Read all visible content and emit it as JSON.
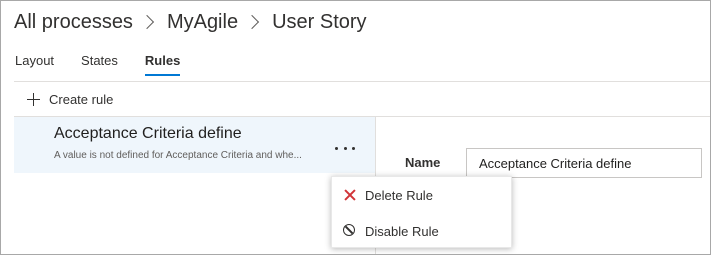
{
  "breadcrumb": {
    "items": [
      "All processes",
      "MyAgile",
      "User Story"
    ]
  },
  "tabs": [
    {
      "label": "Layout",
      "active": false
    },
    {
      "label": "States",
      "active": false
    },
    {
      "label": "Rules",
      "active": true
    }
  ],
  "toolbar": {
    "create_rule_label": "Create rule"
  },
  "rules": [
    {
      "title": "Acceptance Criteria define",
      "description": "A value is not defined for Acceptance Criteria and whe..."
    }
  ],
  "details": {
    "name_label": "Name",
    "name_value": "Acceptance Criteria define"
  },
  "context_menu": {
    "items": [
      {
        "label": "Delete Rule",
        "icon": "delete-icon"
      },
      {
        "label": "Disable Rule",
        "icon": "disable-icon"
      }
    ]
  },
  "colors": {
    "accent": "#0078d4",
    "selected_row": "#eff6fc",
    "delete_icon": "#d13438"
  }
}
